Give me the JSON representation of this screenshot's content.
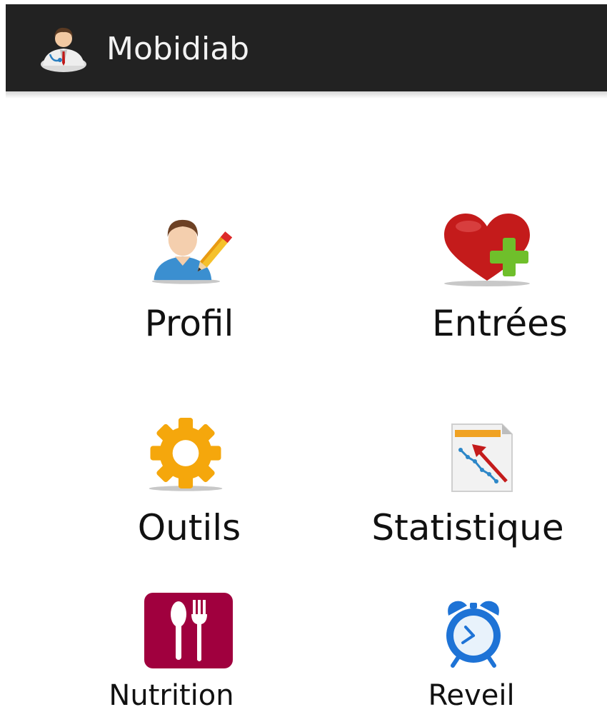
{
  "app": {
    "title": "Mobidiab"
  },
  "menu": {
    "items": [
      {
        "label": "Profil",
        "icon": "user-edit-icon"
      },
      {
        "label": "Entrées",
        "icon": "heart-plus-icon"
      },
      {
        "label": "Outils",
        "icon": "gear-icon"
      },
      {
        "label": "Statistique",
        "icon": "statistics-chart-icon"
      },
      {
        "label": "Nutrition",
        "icon": "utensils-icon"
      },
      {
        "label": "Reveil",
        "icon": "alarm-clock-icon"
      }
    ]
  },
  "colors": {
    "actionbar": "#222222",
    "background": "#ffffff",
    "heart": "#c41b1b",
    "plus": "#6fbf2b",
    "gear": "#f5a70c",
    "nutrition": "#a0003e",
    "alarm": "#1e73d6"
  }
}
